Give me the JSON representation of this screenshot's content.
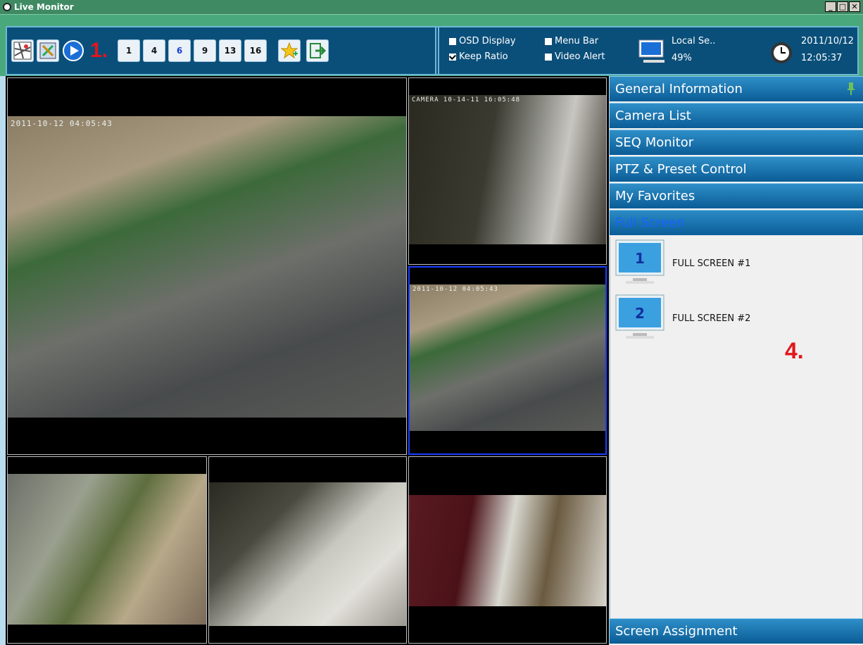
{
  "window": {
    "title": "Live Monitor"
  },
  "toolbar": {
    "step_label": "1.",
    "layout_labels": [
      "1",
      "4",
      "6",
      "9",
      "13",
      "16"
    ],
    "osd_display": {
      "label": "OSD Display",
      "checked": false
    },
    "menu_bar": {
      "label": "Menu Bar",
      "checked": false
    },
    "keep_ratio": {
      "label": "Keep Ratio",
      "checked": true
    },
    "video_alert": {
      "label": "Video Alert",
      "checked": false
    },
    "session_name": "Local Se..",
    "session_percent": "49%",
    "date": "2011/10/12",
    "time": "12:05:37"
  },
  "video": {
    "main_osd": "2011-10-12 04:05:43",
    "cam2_osd": "CAMERA 10-14-11 16:05:48",
    "cam3_osd": "2011-10-12 04:05:43"
  },
  "panel": {
    "headers": [
      "General Information",
      "Camera List",
      "SEQ Monitor",
      "PTZ & Preset Control",
      "My Favorites",
      "Full Screen"
    ],
    "full_screens": [
      {
        "number": "1",
        "label": "FULL SCREEN #1"
      },
      {
        "number": "2",
        "label": "FULL SCREEN #2"
      }
    ],
    "step_label": "4.",
    "footer": "Screen Assignment"
  },
  "colors": {
    "title_bar": "#3f8a63",
    "toolbar": "#4aa97c",
    "panel_header": "#0a5c96",
    "accent": "#e2161b"
  }
}
